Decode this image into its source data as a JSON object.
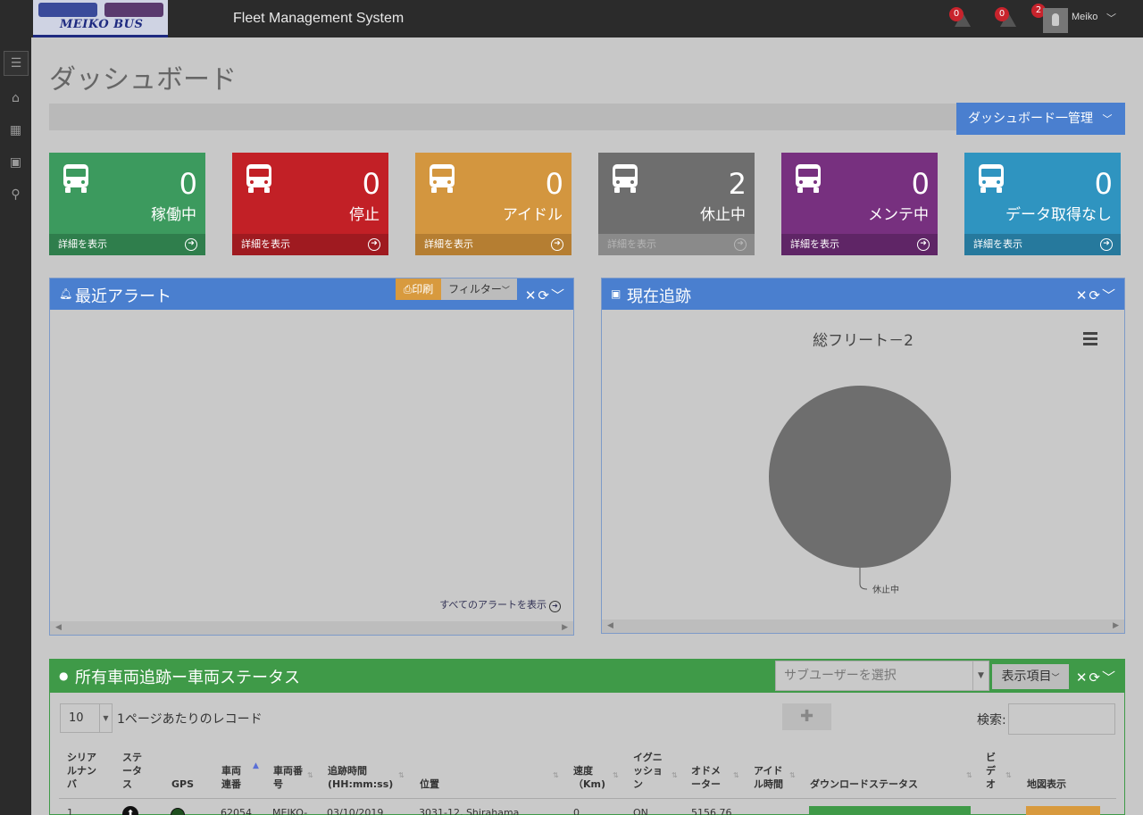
{
  "header": {
    "logo_text": "MEIKO BUS",
    "app_title": "Fleet Management System",
    "alerts": [
      {
        "count": "0"
      },
      {
        "count": "0"
      }
    ],
    "user": {
      "badge": "2",
      "name": "Meiko"
    }
  },
  "page": {
    "title": "ダッシュボード",
    "dashboard_menu": "ダッシュボード一管理"
  },
  "tiles": [
    {
      "count": "0",
      "label": "稼働中",
      "link": "詳細を表示",
      "color": "#3c9a5e"
    },
    {
      "count": "0",
      "label": "停止",
      "link": "詳細を表示",
      "color": "#c22026"
    },
    {
      "count": "0",
      "label": "アイドル",
      "link": "詳細を表示",
      "color": "#d3963f"
    },
    {
      "count": "2",
      "label": "休止中",
      "link": "詳細を表示",
      "color": "#6e6e6e"
    },
    {
      "count": "0",
      "label": "メンテ中",
      "link": "詳細を表示",
      "color": "#77307f"
    },
    {
      "count": "0",
      "label": "データ取得なし",
      "link": "詳細を表示",
      "color": "#2f94c0"
    }
  ],
  "alerts_panel": {
    "title": "最近アラート",
    "print": "印刷",
    "filter": "フィルター",
    "view_all": "すべてのアラートを表示"
  },
  "tracking_panel": {
    "title": "現在追跡",
    "chart_title": "総フリート－2"
  },
  "chart_data": {
    "type": "pie",
    "title": "総フリート－2",
    "categories": [
      "休止中"
    ],
    "values": [
      2
    ],
    "colors": [
      "#6e6e6e"
    ]
  },
  "fleet_panel": {
    "title": "所有車両追跡ー車両ステータス",
    "subuser_placeholder": "サブユーザーを選択",
    "columns_button": "表示項目",
    "page_length": "10",
    "page_length_label": "1ページあたりのレコード",
    "search_label": "検索:",
    "headers": [
      "シリアルナンバ",
      "ステータス",
      "GPS",
      "車両連番",
      "車両番号",
      "追跡時間 (HH:mm:ss)",
      "位置",
      "速度（Km)",
      "イグニッション",
      "オドメーター",
      "アイドル時間",
      "ダウンロードステータス",
      "ビデオ",
      "地図表示"
    ],
    "row": {
      "serial": "1",
      "vehicle_seq": "62054",
      "vehicle_no": "MEIKO-",
      "time": "03/10/2019",
      "location": "3031-12, Shirahama",
      "speed": "0",
      "ignition": "ON",
      "odometer": "5156.76"
    }
  }
}
